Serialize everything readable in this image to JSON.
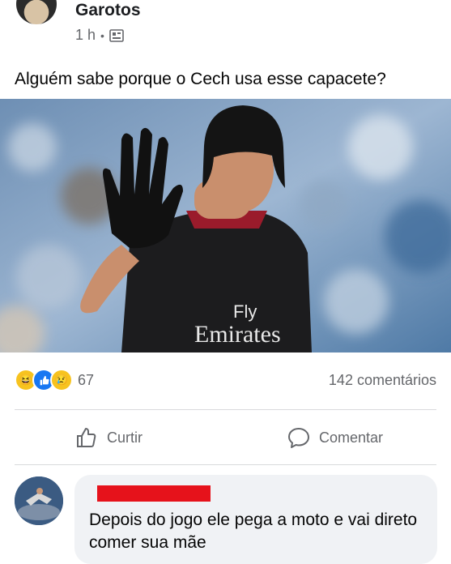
{
  "post": {
    "author": "Garotos",
    "time": "1 h",
    "separator": "•",
    "privacy_icon": "public-page-icon",
    "text": "Alguém sabe porque o Cech usa esse capacete?"
  },
  "photo": {
    "jersey_brand": "Fly",
    "jersey_sponsor": "Emirates"
  },
  "reactions": {
    "icons": [
      "haha-reaction-icon",
      "like-reaction-icon",
      "sad-reaction-icon"
    ],
    "count": "67",
    "comments": "142 comentários"
  },
  "actions": {
    "like_label": "Curtir",
    "comment_label": "Comentar"
  },
  "comment": {
    "text": "Depois do jogo ele pega a moto e vai direto comer sua mãe"
  },
  "colors": {
    "text_secondary": "#65676b",
    "bubble_bg": "#f0f2f5",
    "redaction": "#e6121b",
    "like_blue": "#1877f2"
  }
}
